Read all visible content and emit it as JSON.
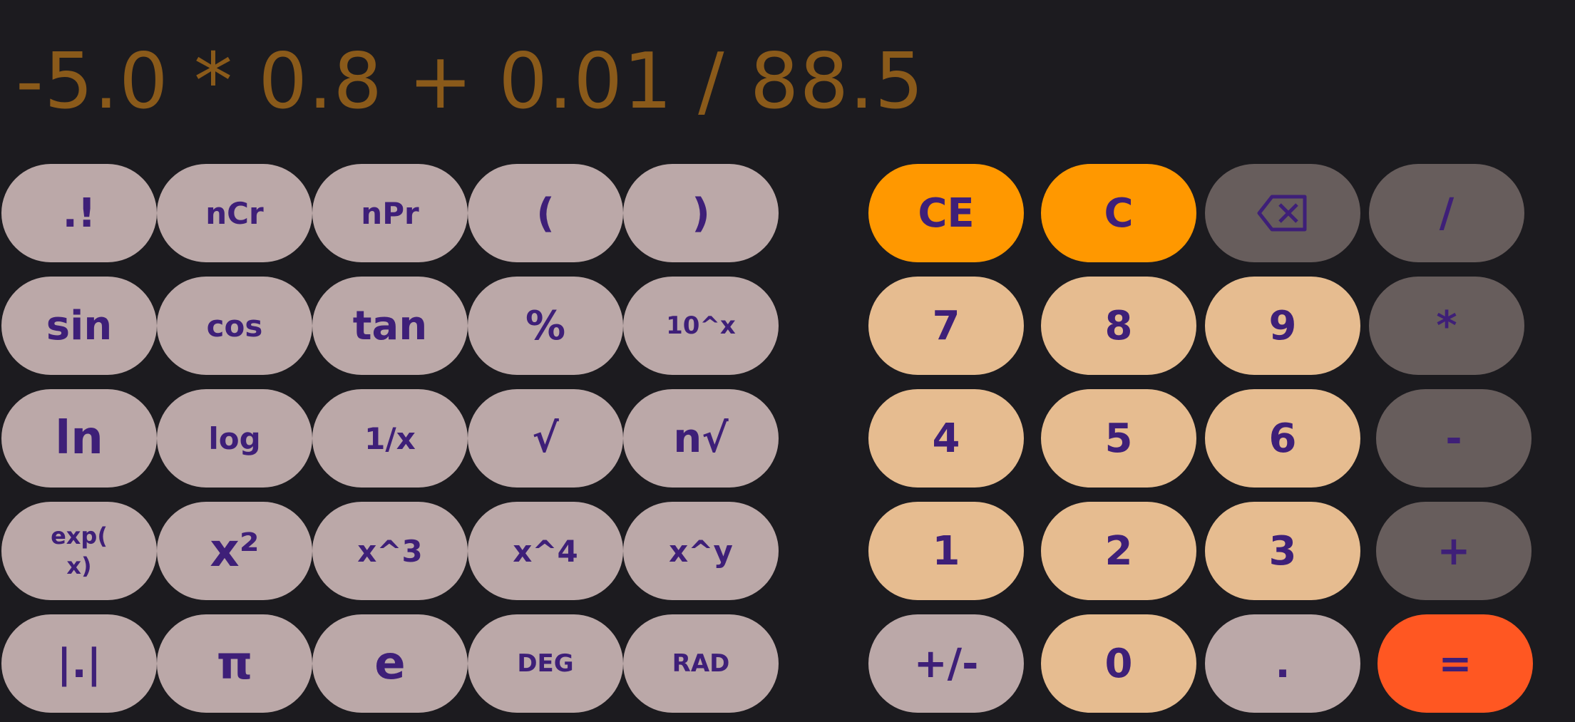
{
  "display": {
    "expression": "-5.0 * 0.8 + 0.01 / 88.5"
  },
  "scientific": {
    "row1": [
      ".!",
      "nCr",
      "nPr",
      "(",
      ")"
    ],
    "row2": [
      "sin",
      "cos",
      "tan",
      "%",
      "10^x"
    ],
    "row3": [
      "ln",
      "log",
      "1/x",
      "√",
      "n√"
    ],
    "row4": [
      "exp(\nx)",
      "x²",
      "x^3",
      "x^4",
      "x^y"
    ],
    "row5": [
      "|.|",
      "π",
      "e",
      "DEG",
      "RAD"
    ]
  },
  "keypad": {
    "row1": [
      "CE",
      "C",
      "backspace",
      "/"
    ],
    "row2": [
      "7",
      "8",
      "9",
      "*"
    ],
    "row3": [
      "4",
      "5",
      "6",
      "-"
    ],
    "row4": [
      "1",
      "2",
      "3",
      "+"
    ],
    "row5": [
      "+/-",
      "0",
      ".",
      "="
    ]
  },
  "colors": {
    "background": "#1c1b1f",
    "display_text": "#8a5a1a",
    "key_text": "#3e1f78",
    "function_key": "#bba8a8",
    "digit_key": "#e6bc90",
    "operator_key": "#675d5c",
    "clear_key": "#ff9800",
    "equals_key": "#ff5722"
  }
}
